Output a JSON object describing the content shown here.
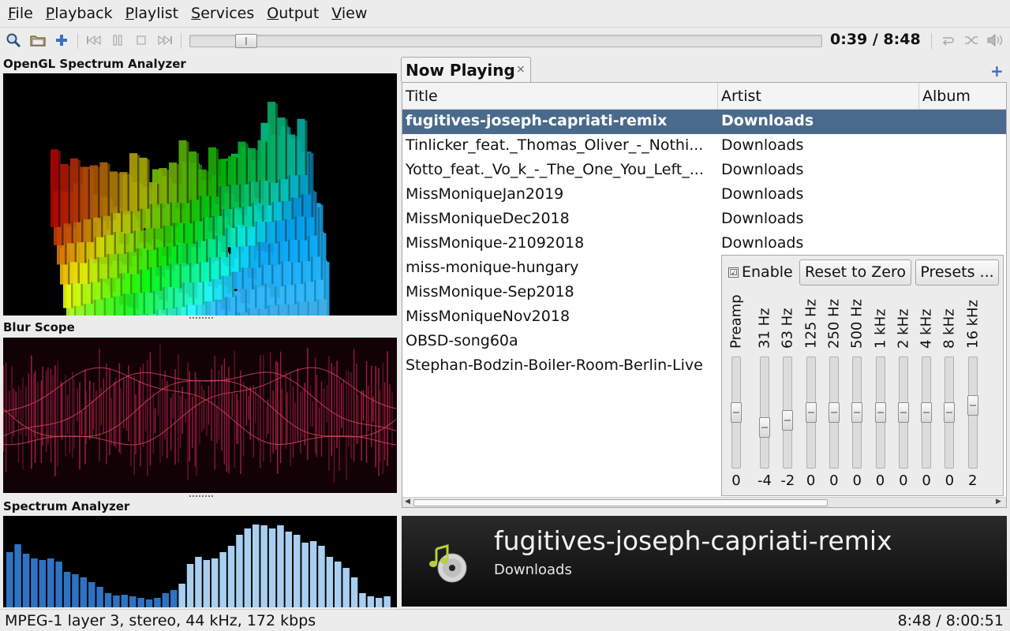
{
  "menu": [
    {
      "accel": "F",
      "rest": "ile"
    },
    {
      "accel": "P",
      "rest": "layback"
    },
    {
      "accel": "P",
      "rest": "laylist"
    },
    {
      "accel": "S",
      "rest": "ervices"
    },
    {
      "accel": "O",
      "rest": "utput"
    },
    {
      "accel": "V",
      "rest": "iew"
    }
  ],
  "toolbar": {
    "time": "0:39 / 8:48",
    "seek_progress": 0.074,
    "icons": [
      "search-icon",
      "open-folder-icon",
      "add-icon",
      "previous-icon",
      "pause-icon",
      "stop-icon",
      "next-icon",
      "repeat-icon",
      "shuffle-icon",
      "volume-icon"
    ]
  },
  "visualizations": {
    "opengl_title": "OpenGL Spectrum Analyzer",
    "blur_title": "Blur Scope",
    "spectrum_title": "Spectrum Analyzer"
  },
  "tabs": [
    {
      "label": "Now Playing",
      "close": "×"
    }
  ],
  "tab_add": "+",
  "playlist": {
    "columns": [
      "Title",
      "Artist",
      "Album"
    ],
    "rows": [
      {
        "title": "fugitives-joseph-capriati-remix",
        "artist": "Downloads",
        "selected": true
      },
      {
        "title": "Tinlicker_feat._Thomas_Oliver_-_Nothi...",
        "artist": "Downloads"
      },
      {
        "title": "Yotto_feat._Vo_k_-_The_One_You_Left_...",
        "artist": "Downloads"
      },
      {
        "title": "MissMoniqueJan2019",
        "artist": "Downloads"
      },
      {
        "title": "MissMoniqueDec2018",
        "artist": "Downloads"
      },
      {
        "title": "MissMonique-21092018",
        "artist": "Downloads"
      },
      {
        "title": "miss-monique-hungary",
        "artist": ""
      },
      {
        "title": "MissMonique-Sep2018",
        "artist": ""
      },
      {
        "title": "MissMoniqueNov2018",
        "artist": ""
      },
      {
        "title": "OBSD-song60a",
        "artist": ""
      },
      {
        "title": "Stephan-Bodzin-Boiler-Room-Berlin-Live",
        "artist": ""
      }
    ]
  },
  "equalizer": {
    "enabled": true,
    "check": "☑",
    "enable_label": "Enable",
    "reset_label": "Reset to Zero",
    "presets_label": "Presets ...",
    "range": [
      -12,
      12
    ],
    "bands": [
      {
        "label": "Preamp",
        "value": 0
      },
      {
        "label": "31 Hz",
        "value": -4
      },
      {
        "label": "63 Hz",
        "value": -2
      },
      {
        "label": "125 Hz",
        "value": 0
      },
      {
        "label": "250 Hz",
        "value": 0
      },
      {
        "label": "500 Hz",
        "value": 0
      },
      {
        "label": "1 kHz",
        "value": 0
      },
      {
        "label": "2 kHz",
        "value": 0
      },
      {
        "label": "4 kHz",
        "value": 0
      },
      {
        "label": "8 kHz",
        "value": 0
      },
      {
        "label": "16 kHz",
        "value": 2
      }
    ]
  },
  "now_playing": {
    "title": "fugitives-joseph-capriati-remix",
    "artist": "Downloads"
  },
  "status": {
    "format": "MPEG-1 layer 3, stereo, 44 kHz, 172 kbps",
    "total": "8:48 / 8:00:51"
  }
}
